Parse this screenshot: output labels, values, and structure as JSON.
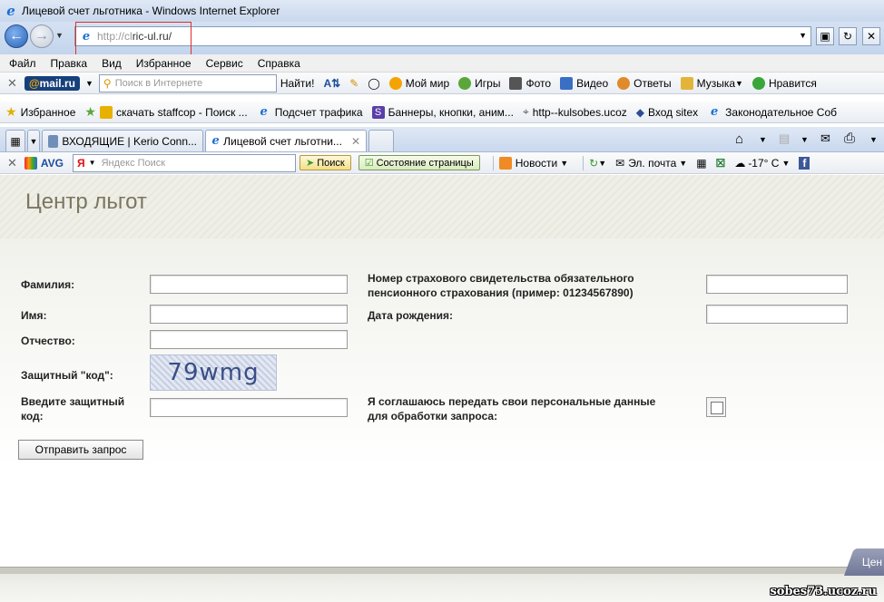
{
  "window": {
    "title": "Лицевой счет льготника - Windows Internet Explorer"
  },
  "address": {
    "url_prefix": "http://cl",
    "url_host": "ric-ul.ru/"
  },
  "menu": [
    "Файл",
    "Правка",
    "Вид",
    "Избранное",
    "Сервис",
    "Справка"
  ],
  "mailru_bar": {
    "brand_at": "@",
    "brand": "mail.ru",
    "search_placeholder": "Поиск в Интернете",
    "find_label": "Найти!",
    "items": [
      "Мой мир",
      "Игры",
      "Фото",
      "Видео",
      "Ответы",
      "Музыка",
      "Нравится"
    ]
  },
  "favorites_bar": {
    "favorites_label": "Избранное",
    "links": [
      "скачать staffcop - Поиск ...",
      "Подсчет трафика",
      "Баннеры, кнопки, аним...",
      "http--kulsobes.ucoz",
      "Вход sitex",
      "Законодательное Соб"
    ]
  },
  "tabs": [
    {
      "label": "ВХОДЯЩИЕ | Kerio Conn...",
      "active": false
    },
    {
      "label": "Лицевой счет льготни...",
      "active": true
    }
  ],
  "avg_bar": {
    "brand": "AVG",
    "yandex_mark": "Я",
    "yandex_placeholder": "Яндекс Поиск",
    "search_label": "Поиск",
    "status_label": "Состояние страницы",
    "news_label": "Новости",
    "mail_label": "Эл. почта",
    "weather": "-17° C"
  },
  "page": {
    "header_title": "Центр льгот",
    "form": {
      "surname_label": "Фамилия:",
      "name_label": "Имя:",
      "patronymic_label": "Отчество:",
      "code_label": "Защитный \"код\":",
      "enter_code_label_1": "Введите защитный",
      "enter_code_label_2": "код:",
      "captcha_text": "79wmg",
      "snils_label_1": "Номер страхового свидетельства обязательного",
      "snils_label_2": "пенсионного страхования (пример: 01234567890)",
      "birth_label": "Дата рождения:",
      "consent_label_1": "Я соглашаюсь передать свои персональные данные",
      "consent_label_2": "для обработки запроса:",
      "submit_label": "Отправить запрос"
    },
    "corner_tab": "Цен"
  },
  "watermark": "sobes73.ucoz.ru"
}
